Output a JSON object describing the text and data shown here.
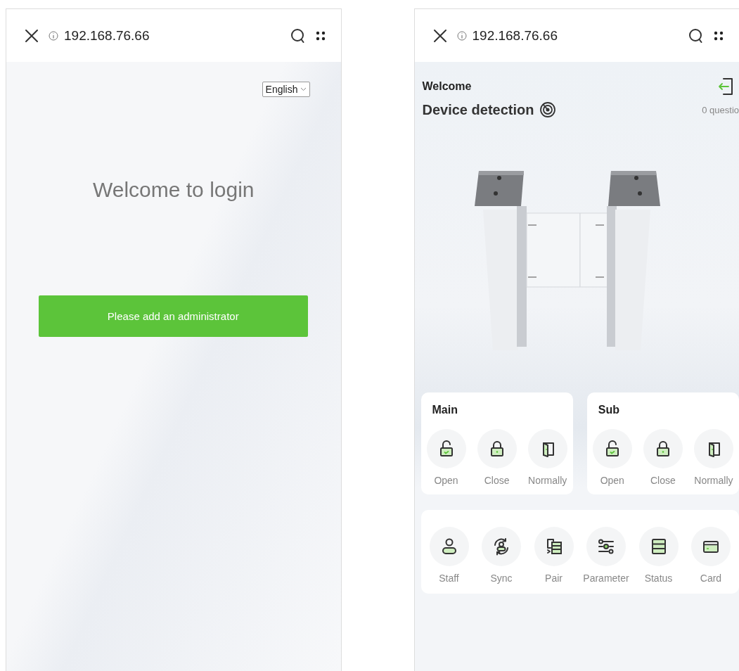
{
  "login_screen": {
    "browser_bar": {
      "url": "192.168.76.66"
    },
    "language_select": {
      "value": "English"
    },
    "title": "Welcome to login",
    "primary_button": "Please add an administrator"
  },
  "home_screen": {
    "browser_bar": {
      "url": "192.168.76.66"
    },
    "greeting": "Welcome",
    "section_title": "Device detection",
    "question_count": "0 questio",
    "gate_panels": [
      {
        "title": "Main",
        "actions": [
          {
            "kind": "open",
            "label": "Open"
          },
          {
            "kind": "close",
            "label": "Close"
          },
          {
            "kind": "normally",
            "label": "Normally"
          }
        ]
      },
      {
        "title": "Sub",
        "actions": [
          {
            "kind": "open",
            "label": "Open"
          },
          {
            "kind": "close",
            "label": "Close"
          },
          {
            "kind": "normally",
            "label": "Normally"
          }
        ]
      }
    ],
    "tools": [
      {
        "kind": "staff",
        "label": "Staff"
      },
      {
        "kind": "sync",
        "label": "Sync"
      },
      {
        "kind": "pair",
        "label": "Pair"
      },
      {
        "kind": "parameter",
        "label": "Parameter"
      },
      {
        "kind": "status",
        "label": "Status"
      },
      {
        "kind": "card",
        "label": "Card"
      }
    ]
  }
}
